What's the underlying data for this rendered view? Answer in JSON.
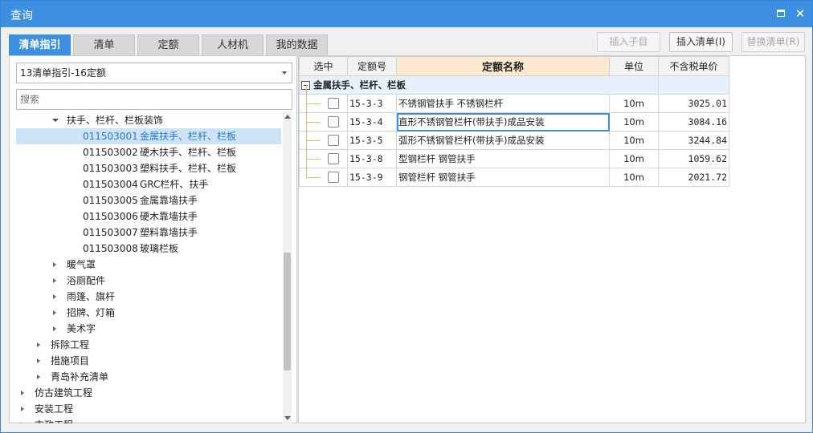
{
  "window": {
    "title": "查询"
  },
  "tabs": [
    "清单指引",
    "清单",
    "定额",
    "人材机",
    "我的数据"
  ],
  "toolbar": {
    "insert_child": "插入子目",
    "insert_list": "插入清单(I)",
    "replace_list": "替换清单(R)"
  },
  "left": {
    "select_value": "13清单指引-16定额",
    "search_placeholder": "搜索",
    "tree": [
      {
        "label": "扶手、栏杆、栏板装饰",
        "code": "",
        "expanded": true
      },
      {
        "code": "011503001",
        "label": "金属扶手、栏杆、栏板",
        "selected": true
      },
      {
        "code": "011503002",
        "label": "硬木扶手、栏杆、栏板"
      },
      {
        "code": "011503003",
        "label": "塑料扶手、栏杆、栏板"
      },
      {
        "code": "011503004",
        "label": "GRC栏杆、扶手"
      },
      {
        "code": "011503005",
        "label": "金属靠墙扶手"
      },
      {
        "code": "011503006",
        "label": "硬木靠墙扶手"
      },
      {
        "code": "011503007",
        "label": "塑料靠墙扶手"
      },
      {
        "code": "011503008",
        "label": "玻璃栏板"
      },
      {
        "label": "暖气罩"
      },
      {
        "label": "浴厕配件"
      },
      {
        "label": "雨篷、旗杆"
      },
      {
        "label": "招牌、灯箱"
      },
      {
        "label": "美术字"
      },
      {
        "label": "拆除工程"
      },
      {
        "label": "措施项目"
      },
      {
        "label": "青岛补充清单"
      },
      {
        "label": "仿古建筑工程"
      },
      {
        "label": "安装工程"
      },
      {
        "label": "市政工程"
      }
    ]
  },
  "grid": {
    "headers": [
      "选中",
      "定额号",
      "定额名称",
      "单位",
      "不含税单价"
    ],
    "group_label": "金属扶手、栏杆、栏板",
    "rows": [
      {
        "code": "15-3-3",
        "name": "不锈钢管扶手 不锈钢栏杆",
        "unit": "10m",
        "price": "3025.01"
      },
      {
        "code": "15-3-4",
        "name": "直形不锈钢管栏杆(带扶手)成品安装",
        "unit": "10m",
        "price": "3084.16"
      },
      {
        "code": "15-3-5",
        "name": "弧形不锈钢管栏杆(带扶手)成品安装",
        "unit": "10m",
        "price": "3244.84"
      },
      {
        "code": "15-3-8",
        "name": "型钢栏杆 钢管扶手",
        "unit": "10m",
        "price": "1059.62"
      },
      {
        "code": "15-3-9",
        "name": "钢管栏杆 钢管扶手",
        "unit": "10m",
        "price": "2021.72"
      }
    ]
  }
}
